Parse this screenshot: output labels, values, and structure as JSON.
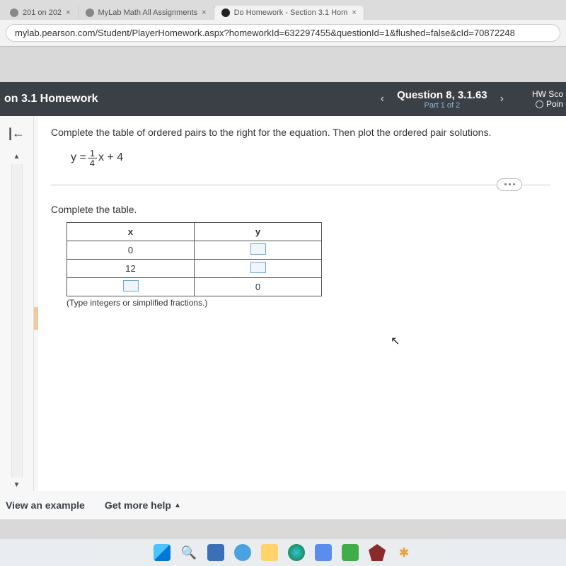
{
  "browser": {
    "tabs": [
      {
        "label": "201 on 202",
        "active": false
      },
      {
        "label": "MyLab Math All Assignments",
        "active": false
      },
      {
        "label": "Do Homework - Section 3.1 Hom",
        "active": true
      }
    ],
    "url": "mylab.pearson.com/Student/PlayerHomework.aspx?homeworkId=632297455&questionId=1&flushed=false&cId=70872248"
  },
  "header": {
    "assignment_title": "on 3.1 Homework",
    "question_label": "Question 8, 3.1.63",
    "part_label": "Part 1 of 2",
    "score_label_1": "HW Sco",
    "score_label_2": "Poin"
  },
  "problem": {
    "instruction": "Complete the table of ordered pairs to the right for the equation. Then plot the ordered pair solutions.",
    "equation_prefix": "y = ",
    "equation_frac_top": "1",
    "equation_frac_bot": "4",
    "equation_suffix": "x + 4",
    "table_label": "Complete the table.",
    "col_x": "x",
    "col_y": "y",
    "rows": [
      {
        "x": "0",
        "y": ""
      },
      {
        "x": "12",
        "y": ""
      },
      {
        "x": "",
        "y": "0"
      }
    ],
    "note": "(Type integers or simplified fractions.)"
  },
  "footer": {
    "view_example": "View an example",
    "get_help": "Get more help"
  }
}
